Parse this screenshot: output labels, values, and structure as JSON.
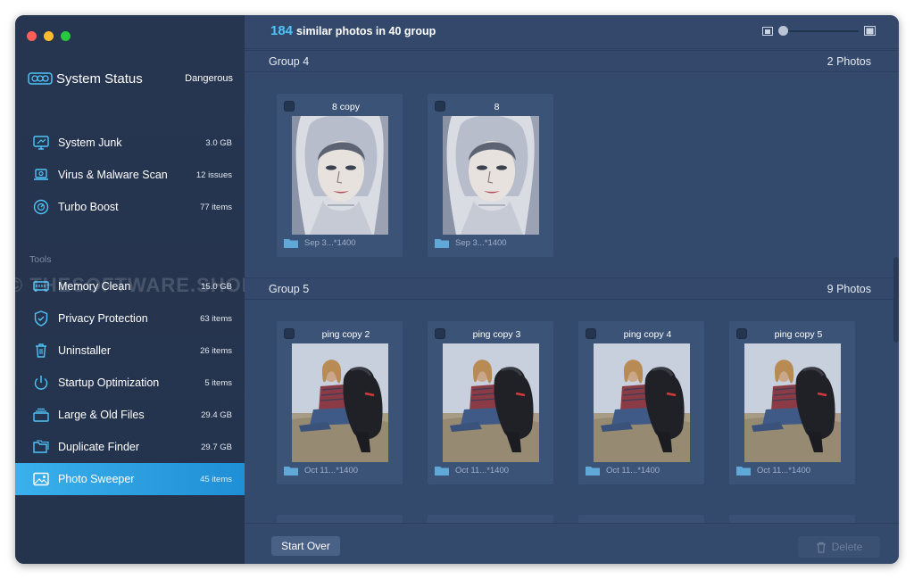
{
  "sidebar": {
    "status_title": "System Status",
    "status_value": "Dangerous",
    "items": [
      {
        "label": "System Junk",
        "count": "3.0 GB",
        "icon": "monitor-icon"
      },
      {
        "label": "Virus & Malware Scan",
        "count": "12 issues",
        "icon": "laptop-scan-icon"
      },
      {
        "label": "Turbo Boost",
        "count": "77 items",
        "icon": "speedometer-icon"
      }
    ],
    "tools_label": "Tools",
    "tools": [
      {
        "label": "Memory Clean",
        "count": "15.0 GB",
        "icon": "memory-chip-icon"
      },
      {
        "label": "Privacy Protection",
        "count": "63 items",
        "icon": "shield-check-icon"
      },
      {
        "label": "Uninstaller",
        "count": "26 items",
        "icon": "trash-icon"
      },
      {
        "label": "Startup Optimization",
        "count": "5 items",
        "icon": "power-icon"
      },
      {
        "label": "Large & Old Files",
        "count": "29.4 GB",
        "icon": "files-stack-icon"
      },
      {
        "label": "Duplicate Finder",
        "count": "29.7 GB",
        "icon": "duplicate-folder-icon"
      },
      {
        "label": "Photo Sweeper",
        "count": "45 items",
        "icon": "photo-icon",
        "active": true
      }
    ]
  },
  "watermark": "© THESOFTWARE.SHOP",
  "header": {
    "count": "184",
    "text": "similar photos in 40 group"
  },
  "groups": [
    {
      "name": "Group 4",
      "count": "2 Photos",
      "photos": [
        {
          "name": "8 copy",
          "meta": "Sep 3...*1400",
          "kind": "portrait"
        },
        {
          "name": "8",
          "meta": "Sep 3...*1400",
          "kind": "portrait"
        }
      ]
    },
    {
      "name": "Group 5",
      "count": "9 Photos",
      "photos": [
        {
          "name": "ping copy 2",
          "meta": "Oct 11...*1400",
          "kind": "dog"
        },
        {
          "name": "ping copy 3",
          "meta": "Oct 11...*1400",
          "kind": "dog"
        },
        {
          "name": "ping copy 4",
          "meta": "Oct 11...*1400",
          "kind": "dog"
        },
        {
          "name": "ping copy 5",
          "meta": "Oct 11...*1400",
          "kind": "dog"
        }
      ]
    }
  ],
  "footer": {
    "start_over": "Start Over",
    "delete": "Delete"
  },
  "colors": {
    "accent": "#3ab0ec",
    "count_highlight": "#4fc3f7",
    "sidebar_bg": "#263550",
    "main_bg": "#344a6c"
  }
}
